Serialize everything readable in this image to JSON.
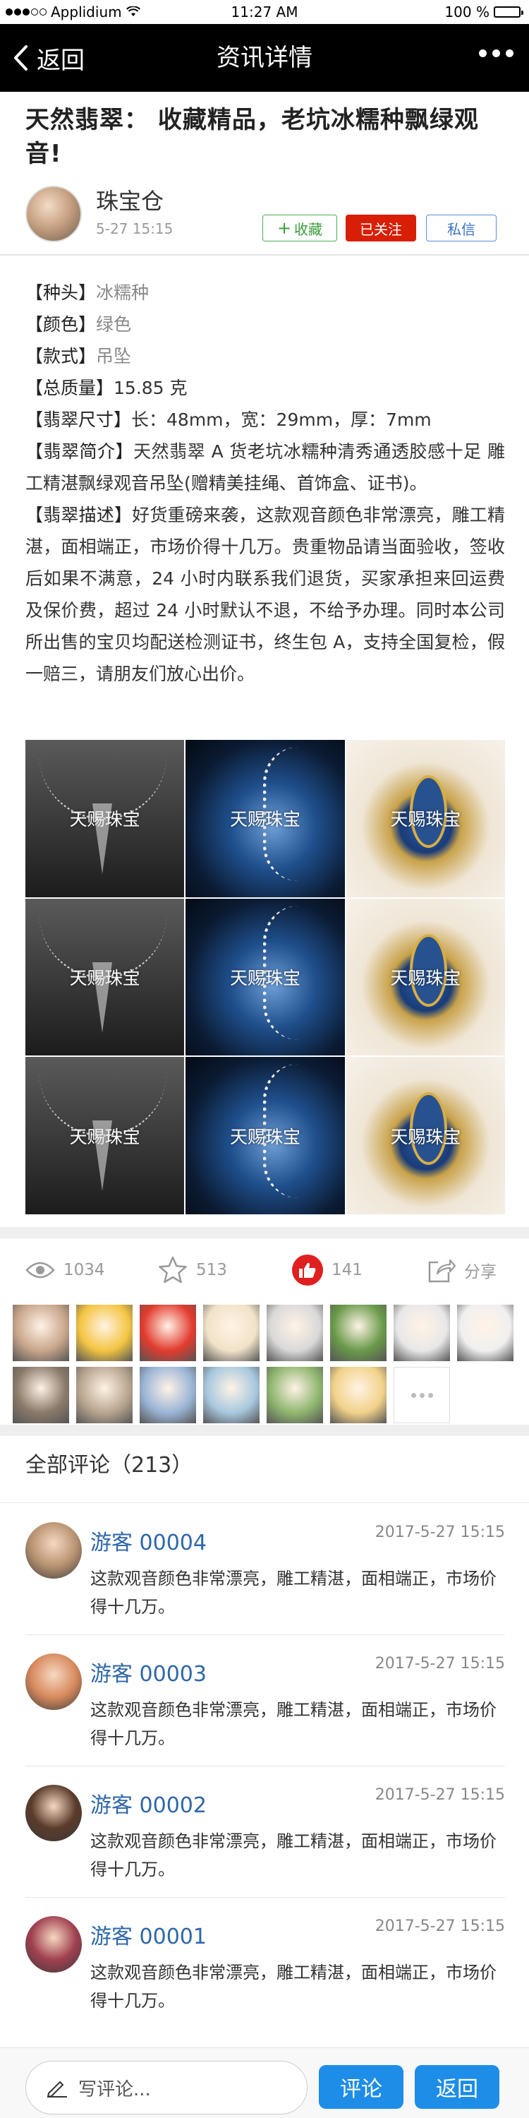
{
  "status_bar": {
    "carrier": "Applidium",
    "time": "11:27 AM",
    "battery_percent": "100 %",
    "battery_level": 1.0
  },
  "nav": {
    "back_label": "返回",
    "title": "资讯详情"
  },
  "article": {
    "title": "天然翡翠： 收藏精品，老坑冰糯种飘绿观音!",
    "author": "珠宝仓",
    "date": "5-27 15:15",
    "follow_label": "收藏",
    "followed_label": "已关注",
    "message_label": "私信"
  },
  "specs": {
    "variety_key": "【种头】",
    "variety_value": "冰糯种",
    "color_key": "【颜色】",
    "color_value": "绿色",
    "style_key": "【款式】",
    "style_value": "吊坠",
    "weight_key": "【总质量】",
    "weight_value": "15.85 克",
    "size_key": "【翡翠尺寸】",
    "size_value": "长：48mm，宽：29mm，厚：7mm",
    "intro_key": "【翡翠简介】",
    "intro_value": "天然翡翠 A 货老坑冰糯种清秀通透胶感十足 雕工精湛飘绿观音吊坠(赠精美挂绳、首饰盒、证书)。",
    "desc_key": "【翡翠描述】",
    "desc_value": "好货重磅来袭，这款观音颜色非常漂亮，雕工精湛，面相端正，市场价得十几万。贵重物品请当面验收，签收后如果不满意，24 小时内联系我们退货，买家承担来回运费及保价费，超过 24 小时默认不退，不给予办理。同时本公司所出售的宝贝均配送检测证书，终生包 A，支持全国复检，假一赔三，请朋友们放心出价。"
  },
  "gallery": {
    "watermark": "天赐珠宝",
    "images": [
      "necklace",
      "sapphire",
      "ring",
      "necklace",
      "sapphire",
      "ring",
      "necklace",
      "sapphire",
      "ring"
    ]
  },
  "stats": {
    "views": "1034",
    "favorites": "513",
    "likes": "141",
    "share_label": "分享"
  },
  "liked_users": {
    "avatars": [
      "girl-1",
      "cartoon-yellow",
      "cartoon-fox",
      "cat",
      "sunglasses",
      "girl-green",
      "sketch-1",
      "sketch-2",
      "child",
      "flowers",
      "girl-3",
      "beach",
      "tree",
      "cartoon-boy"
    ],
    "avatar_colors": [
      "#c9a68c",
      "#f4c542",
      "#e23b2e",
      "#f1e2c8",
      "#d9d9d9",
      "#6a9a4a",
      "#e8e8e8",
      "#f0f0f0",
      "#8a7a6a",
      "#b8a58f",
      "#9bb5d6",
      "#a8c8de",
      "#8fb66f",
      "#f2d28a"
    ]
  },
  "comments_section": {
    "header": "全部评论（213）",
    "items": [
      {
        "name": "游客 00004",
        "time": "2017-5-27 15:15",
        "text": "这款观音颜色非常漂亮，雕工精湛，面相端正，市场价得十几万。",
        "avatar_color": "#b99372"
      },
      {
        "name": "游客 00003",
        "time": "2017-5-27 15:15",
        "text": "这款观音颜色非常漂亮，雕工精湛，面相端正，市场价得十几万。",
        "avatar_color": "#d88a5e"
      },
      {
        "name": "游客 00002",
        "time": "2017-5-27 15:15",
        "text": "这款观音颜色非常漂亮，雕工精湛，面相端正，市场价得十几万。",
        "avatar_color": "#5a3b2b"
      },
      {
        "name": "游客 00001",
        "time": "2017-5-27 15:15",
        "text": "这款观音颜色非常漂亮，雕工精湛，面相端正，市场价得十几万。",
        "avatar_color": "#a04050"
      }
    ]
  },
  "bottom_bar": {
    "input_placeholder": "写评论...",
    "comment_label": "评论",
    "return_label": "返回"
  },
  "colors": {
    "nav_bg": "#000000",
    "accent_blue": "#1e8de8",
    "accent_red": "#d81e06",
    "accent_green": "#3a9d3a",
    "link_blue": "#2e67a8"
  }
}
